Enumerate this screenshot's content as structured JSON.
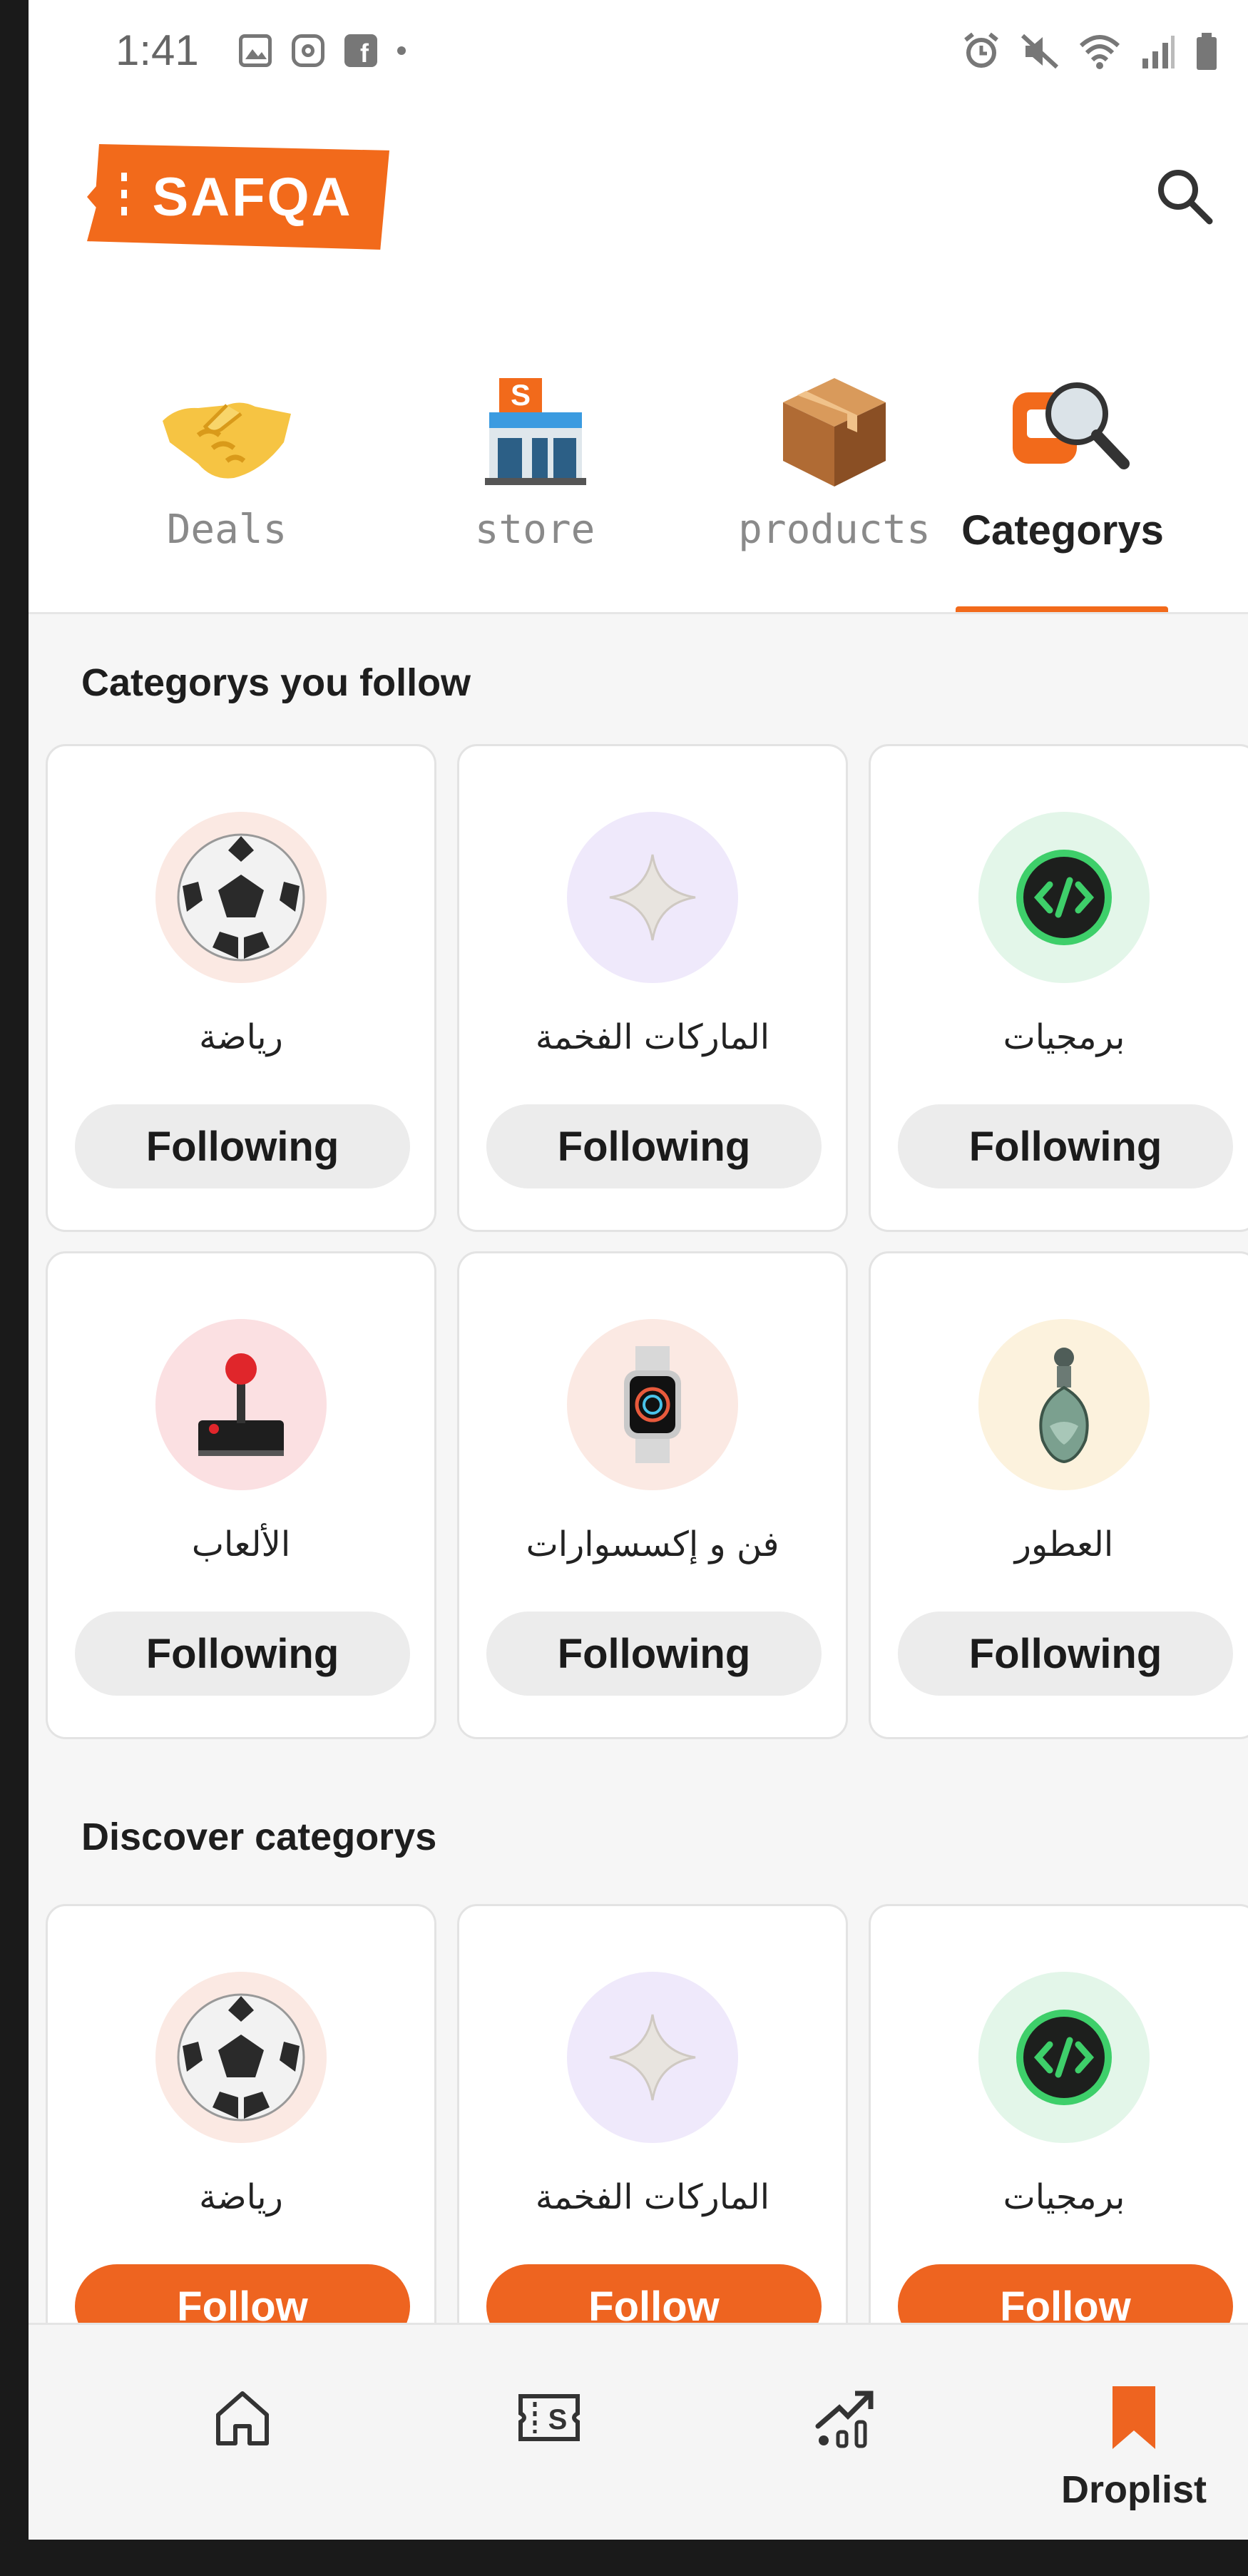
{
  "status_bar": {
    "time": "1:41",
    "left_icons": [
      "gallery-icon",
      "instagram-icon",
      "facebook-icon",
      "dot-icon"
    ],
    "right_icons": [
      "alarm-icon",
      "mute-icon",
      "wifi-icon",
      "signal-icon",
      "battery-icon"
    ]
  },
  "header": {
    "logo_text": "SAFQA",
    "search_icon": "search-icon"
  },
  "tabs": [
    {
      "label": "Deals",
      "icon": "handshake-icon",
      "active": false
    },
    {
      "label": "store",
      "icon": "store-icon",
      "active": false
    },
    {
      "label": "products",
      "icon": "package-icon",
      "active": false
    },
    {
      "label": "Categorys",
      "icon": "category-search-icon",
      "active": true
    }
  ],
  "followed_section": {
    "title": "Categorys you follow",
    "cards": [
      {
        "name": "رياضة",
        "icon": "soccer-ball-icon",
        "button": "Following"
      },
      {
        "name": "الماركات الفخمة",
        "icon": "sparkle-icon",
        "button": "Following"
      },
      {
        "name": "برمجيات",
        "icon": "code-icon",
        "button": "Following"
      },
      {
        "name": "الألعاب",
        "icon": "joystick-icon",
        "button": "Following"
      },
      {
        "name": "فن و إكسسوارات",
        "icon": "smartwatch-icon",
        "button": "Following"
      },
      {
        "name": "العطور",
        "icon": "perfume-icon",
        "button": "Following"
      }
    ]
  },
  "discover_section": {
    "title": "Discover categorys",
    "cards": [
      {
        "name": "رياضة",
        "icon": "soccer-ball-icon",
        "button": "Follow"
      },
      {
        "name": "الماركات الفخمة",
        "icon": "sparkle-icon",
        "button": "Follow"
      },
      {
        "name": "برمجيات",
        "icon": "code-icon",
        "button": "Follow"
      }
    ]
  },
  "bottom_nav": [
    {
      "label": "",
      "icon": "home-icon"
    },
    {
      "label": "",
      "icon": "store-ticket-icon"
    },
    {
      "label": "",
      "icon": "trending-icon"
    },
    {
      "label": "Droplist",
      "icon": "bookmark-icon"
    }
  ],
  "colors": {
    "accent": "#ee6420",
    "following_bg": "#ececec",
    "content_bg": "#f6f6f6"
  }
}
